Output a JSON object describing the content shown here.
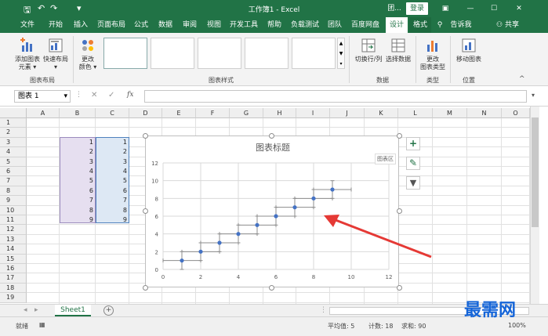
{
  "titlebar": {
    "title": "工作簿1 - Excel",
    "extra_label": "团...",
    "login_label": "登录",
    "qa_save": "🖫",
    "qa_undo": "↶",
    "qa_redo": "↷",
    "qa_more": "▾",
    "minimize": "—",
    "restore": "☐",
    "close": "✕",
    "ribbon_display": "▣"
  },
  "tabs": [
    "文件",
    "开始",
    "插入",
    "页面布局",
    "公式",
    "数据",
    "审阅",
    "视图",
    "开发工具",
    "帮助",
    "负载测试",
    "团队",
    "百度网盘",
    "设计",
    "格式"
  ],
  "tell_me": "告诉我",
  "share": "共享",
  "ribbon": {
    "add_element": "添加图表",
    "add_element2": "元素 ▾",
    "quick_layout": "快速布局",
    "quick_layout2": "▾",
    "change_colors": "更改",
    "change_colors2": "颜色 ▾",
    "switch_row_col": "切换行/列",
    "select_data": "选择数据",
    "change_type": "更改",
    "change_type2": "图表类型",
    "move_chart": "移动图表",
    "group_layout": "图表布局",
    "group_styles": "图表样式",
    "group_data": "数据",
    "group_type": "类型",
    "group_location": "位置"
  },
  "formula": {
    "name_box": "图表 1",
    "fx": "fx",
    "cancel": "✕",
    "enter": "✓",
    "value": ""
  },
  "columns": [
    "A",
    "B",
    "C",
    "D",
    "E",
    "F",
    "G",
    "H",
    "I",
    "J",
    "K",
    "L",
    "M",
    "N",
    "O"
  ],
  "rows": [
    "1",
    "2",
    "3",
    "4",
    "5",
    "6",
    "7",
    "8",
    "9",
    "10",
    "11",
    "12",
    "13",
    "14",
    "15",
    "16",
    "17",
    "18",
    "19"
  ],
  "colB": [
    "1",
    "2",
    "3",
    "4",
    "5",
    "6",
    "7",
    "8",
    "9"
  ],
  "colC": [
    "1",
    "2",
    "3",
    "4",
    "5",
    "6",
    "7",
    "8",
    "9"
  ],
  "chart": {
    "tooltip": "图表区"
  },
  "chart_data": {
    "type": "scatter",
    "title": "图表标题",
    "x": [
      1,
      2,
      3,
      4,
      5,
      6,
      7,
      8,
      9
    ],
    "y": [
      1,
      2,
      3,
      4,
      5,
      6,
      7,
      8,
      9
    ],
    "error_bars": {
      "x": 1,
      "y": 1
    },
    "xlim": [
      0,
      12
    ],
    "ylim": [
      0,
      12
    ],
    "xticks": [
      "0",
      "2",
      "4",
      "6",
      "8",
      "10",
      "12"
    ],
    "yticks": [
      "0",
      "2",
      "4",
      "6",
      "8",
      "10",
      "12"
    ],
    "grid": true,
    "marker_color": "#4472c4"
  },
  "sheet": {
    "tab": "Sheet1",
    "add": "+"
  },
  "status": {
    "ready": "就绪",
    "average": "平均值: 5",
    "count": "计数: 18",
    "sum": "求和: 90",
    "zoom": "100%"
  },
  "watermark": "最需网",
  "colors": {
    "accent": "#217346",
    "selection_b": "#e6dff0",
    "selection_c": "#dde8f4"
  }
}
